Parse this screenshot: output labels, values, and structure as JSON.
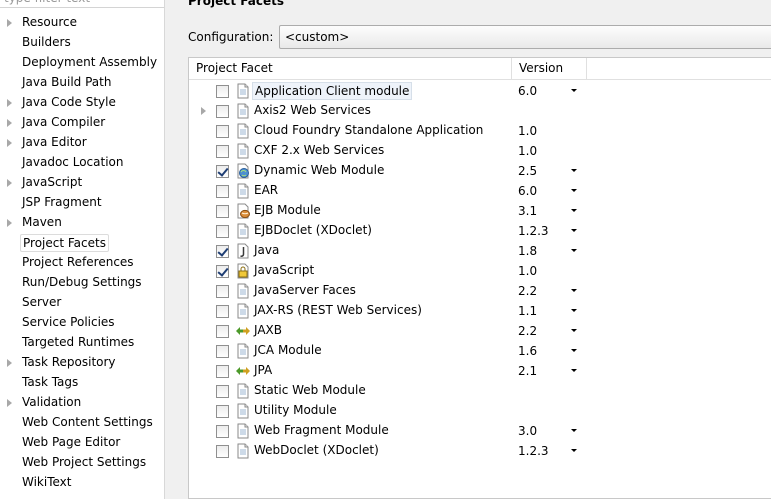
{
  "nav": {
    "filter_placeholder": "type filter text",
    "items": [
      {
        "label": "Resource",
        "expandable": true
      },
      {
        "label": "Builders",
        "expandable": false
      },
      {
        "label": "Deployment Assembly",
        "expandable": false
      },
      {
        "label": "Java Build Path",
        "expandable": false
      },
      {
        "label": "Java Code Style",
        "expandable": true
      },
      {
        "label": "Java Compiler",
        "expandable": true
      },
      {
        "label": "Java Editor",
        "expandable": true
      },
      {
        "label": "Javadoc Location",
        "expandable": false
      },
      {
        "label": "JavaScript",
        "expandable": true
      },
      {
        "label": "JSP Fragment",
        "expandable": false
      },
      {
        "label": "Maven",
        "expandable": true
      },
      {
        "label": "Project Facets",
        "expandable": false,
        "selected": true
      },
      {
        "label": "Project References",
        "expandable": false
      },
      {
        "label": "Run/Debug Settings",
        "expandable": false
      },
      {
        "label": "Server",
        "expandable": false
      },
      {
        "label": "Service Policies",
        "expandable": false
      },
      {
        "label": "Targeted Runtimes",
        "expandable": false
      },
      {
        "label": "Task Repository",
        "expandable": true
      },
      {
        "label": "Task Tags",
        "expandable": false
      },
      {
        "label": "Validation",
        "expandable": true
      },
      {
        "label": "Web Content Settings",
        "expandable": false
      },
      {
        "label": "Web Page Editor",
        "expandable": false
      },
      {
        "label": "Web Project Settings",
        "expandable": false
      },
      {
        "label": "WikiText",
        "expandable": false
      }
    ]
  },
  "page": {
    "title": "Project Facets",
    "configuration_label": "Configuration:",
    "configuration_value": "<custom>"
  },
  "table": {
    "col_facet": "Project Facet",
    "col_version": "Version",
    "rows": [
      {
        "name": "Application Client module",
        "version": "6.0",
        "checked": false,
        "dropdown": true,
        "icon": "page-icon",
        "selected": true
      },
      {
        "name": "Axis2 Web Services",
        "version": "",
        "checked": false,
        "dropdown": false,
        "icon": "page-icon",
        "expandable": true
      },
      {
        "name": "Cloud Foundry Standalone Application",
        "version": "1.0",
        "checked": false,
        "dropdown": false,
        "icon": "page-icon"
      },
      {
        "name": "CXF 2.x Web Services",
        "version": "1.0",
        "checked": false,
        "dropdown": false,
        "icon": "page-icon"
      },
      {
        "name": "Dynamic Web Module",
        "version": "2.5",
        "checked": true,
        "dropdown": true,
        "icon": "web-globe-icon"
      },
      {
        "name": "EAR",
        "version": "6.0",
        "checked": false,
        "dropdown": true,
        "icon": "page-icon"
      },
      {
        "name": "EJB Module",
        "version": "3.1",
        "checked": false,
        "dropdown": true,
        "icon": "ejb-bean-icon"
      },
      {
        "name": "EJBDoclet (XDoclet)",
        "version": "1.2.3",
        "checked": false,
        "dropdown": true,
        "icon": "page-icon"
      },
      {
        "name": "Java",
        "version": "1.8",
        "checked": true,
        "dropdown": true,
        "icon": "java-icon"
      },
      {
        "name": "JavaScript",
        "version": "1.0",
        "checked": true,
        "dropdown": false,
        "icon": "javascript-icon"
      },
      {
        "name": "JavaServer Faces",
        "version": "2.2",
        "checked": false,
        "dropdown": true,
        "icon": "page-icon"
      },
      {
        "name": "JAX-RS (REST Web Services)",
        "version": "1.1",
        "checked": false,
        "dropdown": true,
        "icon": "page-icon"
      },
      {
        "name": "JAXB",
        "version": "2.2",
        "checked": false,
        "dropdown": true,
        "icon": "bidirectional-arrows-icon"
      },
      {
        "name": "JCA Module",
        "version": "1.6",
        "checked": false,
        "dropdown": true,
        "icon": "page-icon"
      },
      {
        "name": "JPA",
        "version": "2.1",
        "checked": false,
        "dropdown": true,
        "icon": "bidirectional-arrows-icon"
      },
      {
        "name": "Static Web Module",
        "version": "",
        "checked": false,
        "dropdown": false,
        "icon": "page-icon"
      },
      {
        "name": "Utility Module",
        "version": "",
        "checked": false,
        "dropdown": false,
        "icon": "page-icon"
      },
      {
        "name": "Web Fragment Module",
        "version": "3.0",
        "checked": false,
        "dropdown": true,
        "icon": "page-icon"
      },
      {
        "name": "WebDoclet (XDoclet)",
        "version": "1.2.3",
        "checked": false,
        "dropdown": true,
        "icon": "page-icon"
      }
    ]
  }
}
